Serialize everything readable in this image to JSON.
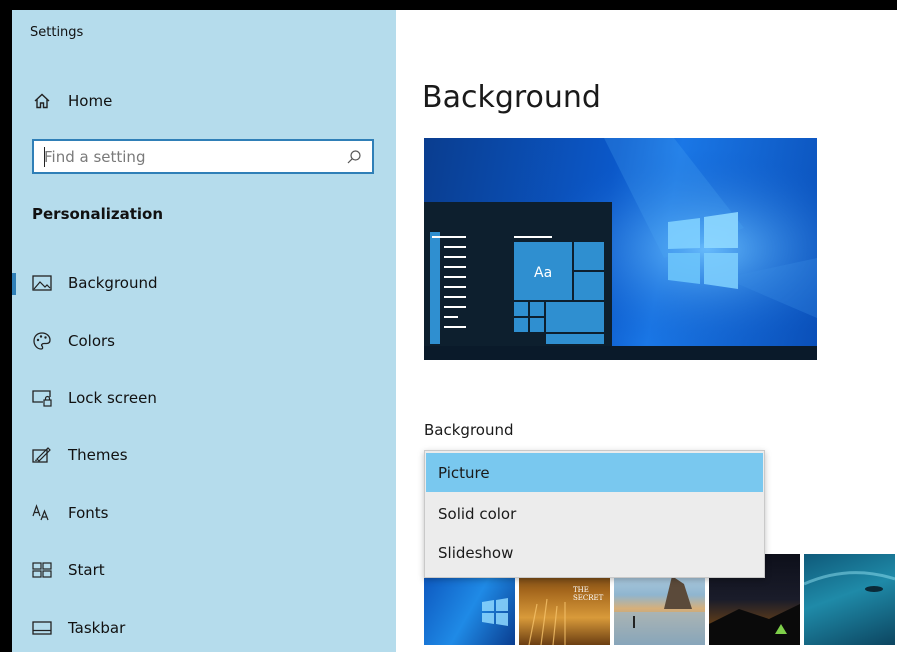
{
  "window": {
    "title": "Settings"
  },
  "sidebar": {
    "home_label": "Home",
    "search_placeholder": "Find a setting",
    "section_title": "Personalization",
    "items": [
      {
        "label": "Background",
        "icon": "picture-icon",
        "active": true
      },
      {
        "label": "Colors",
        "icon": "palette-icon"
      },
      {
        "label": "Lock screen",
        "icon": "lock-screen-icon"
      },
      {
        "label": "Themes",
        "icon": "themes-icon"
      },
      {
        "label": "Fonts",
        "icon": "fonts-icon"
      },
      {
        "label": "Start",
        "icon": "start-icon"
      },
      {
        "label": "Taskbar",
        "icon": "taskbar-icon"
      }
    ]
  },
  "main": {
    "page_title": "Background",
    "preview": {
      "tile_label": "Aa"
    },
    "background_label": "Background",
    "dropdown": {
      "options": [
        "Picture",
        "Solid color",
        "Slideshow"
      ],
      "selected": "Picture"
    },
    "thumbnail_text": [
      "THE SECRET"
    ]
  },
  "colors": {
    "sidebar_bg": "#b5dcec",
    "accent": "#2f7fb7",
    "selected_option": "#79c8ef",
    "preview_tile": "#2f8fd0"
  }
}
